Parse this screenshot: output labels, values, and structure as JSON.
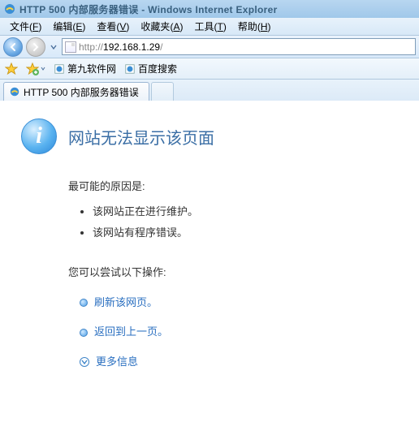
{
  "colors": {
    "accent": "#3a6ea5",
    "link": "#2a6fc0",
    "titlebar_text": "#39607f"
  },
  "titlebar": {
    "text": "HTTP 500 内部服务器错误 - Windows Internet Explorer"
  },
  "menu": {
    "file": {
      "label": "文件",
      "accel": "F"
    },
    "edit": {
      "label": "编辑",
      "accel": "E"
    },
    "view": {
      "label": "查看",
      "accel": "V"
    },
    "fav": {
      "label": "收藏夹",
      "accel": "A"
    },
    "tools": {
      "label": "工具",
      "accel": "T"
    },
    "help": {
      "label": "帮助",
      "accel": "H"
    }
  },
  "nav": {
    "back_icon": "arrow-left",
    "fwd_icon": "arrow-right",
    "url_prefix": "http://",
    "url_host": "192.168.1.29",
    "url_suffix": "/"
  },
  "links_bar": {
    "star_icon": "star",
    "fav_add_icon": "star-add",
    "item1": "第九软件网",
    "item2": "百度搜索"
  },
  "tab": {
    "icon": "ie-e",
    "title": "HTTP 500 内部服务器错误"
  },
  "page": {
    "heading": "网站无法显示该页面",
    "causes_title": "最可能的原因是:",
    "causes": [
      "该网站正在进行维护。",
      "该网站有程序错误。"
    ],
    "actions_title": "您可以尝试以下操作:",
    "action_refresh": "刷新该网页。",
    "action_back": "返回到上一页。",
    "more_info": "更多信息"
  }
}
